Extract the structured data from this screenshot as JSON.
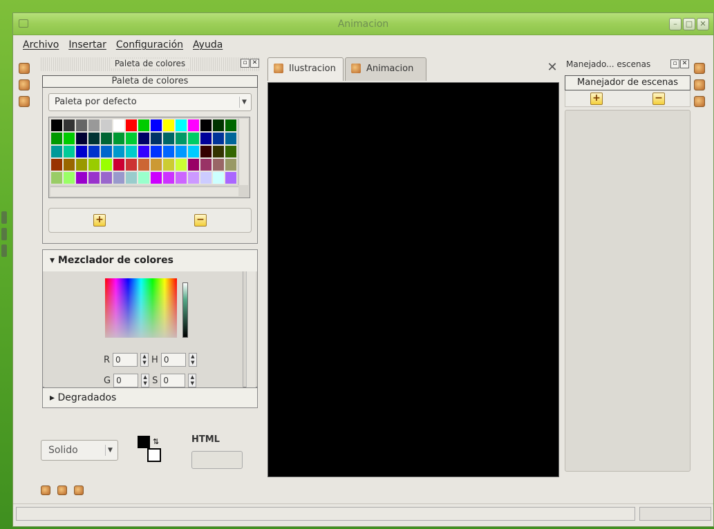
{
  "window": {
    "title": "Animacion"
  },
  "menubar": {
    "items": [
      "Archivo",
      "Insertar",
      "Configuración",
      "Ayuda"
    ]
  },
  "left_dock": {
    "header": "Paleta de colores",
    "group_title": "Paleta de colores",
    "palette_select": "Paleta por defecto",
    "swatch_colors": [
      "#000000",
      "#333333",
      "#666666",
      "#999999",
      "#cccccc",
      "#ffffff",
      "#ff0000",
      "#00cc00",
      "#0000ff",
      "#ffff00",
      "#00ffff",
      "#ff00ff",
      "#000000",
      "#003300",
      "#006600",
      "#009900",
      "#00cc00",
      "#000033",
      "#003333",
      "#006633",
      "#009933",
      "#00cc33",
      "#000066",
      "#003366",
      "#006666",
      "#009966",
      "#00cc66",
      "#000099",
      "#003399",
      "#006699",
      "#009999",
      "#00cc99",
      "#0000cc",
      "#0033cc",
      "#0066cc",
      "#0099cc",
      "#00cccc",
      "#3300ff",
      "#0033ff",
      "#0066ff",
      "#0099ff",
      "#00ccff",
      "#330000",
      "#333300",
      "#336600",
      "#993300",
      "#996600",
      "#999900",
      "#99cc00",
      "#99ff00",
      "#cc0033",
      "#cc3333",
      "#cc6633",
      "#cc9933",
      "#cccc33",
      "#ccff33",
      "#990066",
      "#993366",
      "#996666",
      "#999966",
      "#99cc66",
      "#99ff66",
      "#9900cc",
      "#9933cc",
      "#9966cc",
      "#9999cc",
      "#99cccc",
      "#99ffcc",
      "#cc00ff",
      "#cc33ff",
      "#cc66ff",
      "#cc99ff",
      "#ccccff",
      "#ccffff",
      "#aa66ff"
    ],
    "mixer_title": "Mezclador de colores",
    "mixer_fields": [
      {
        "label": "R",
        "value": "0"
      },
      {
        "label": "H",
        "value": "0"
      },
      {
        "label": "G",
        "value": "0"
      },
      {
        "label": "S",
        "value": "0"
      }
    ],
    "gradients_title": "Degradados",
    "fill_type": "Solido",
    "html_label": "HTML",
    "html_value": ""
  },
  "tabs": [
    {
      "label": "Ilustracion",
      "active": true
    },
    {
      "label": "Animacion",
      "active": false
    }
  ],
  "right_dock": {
    "header": "Manejado... escenas",
    "group_title": "Manejador de escenas"
  },
  "colors": {
    "titlebar": "#9ccf58",
    "canvas": "#000000",
    "window_bg": "#e8e6e0"
  }
}
